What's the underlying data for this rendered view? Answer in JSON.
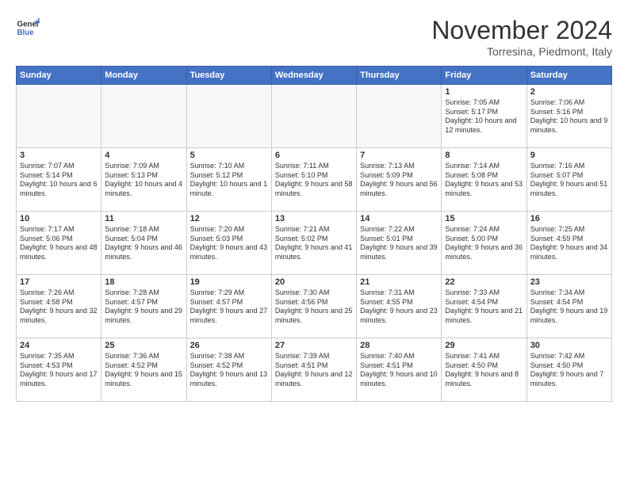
{
  "header": {
    "logo_general": "General",
    "logo_blue": "Blue",
    "month_title": "November 2024",
    "subtitle": "Torresina, Piedmont, Italy"
  },
  "calendar": {
    "days_of_week": [
      "Sunday",
      "Monday",
      "Tuesday",
      "Wednesday",
      "Thursday",
      "Friday",
      "Saturday"
    ],
    "weeks": [
      [
        {
          "day": "",
          "info": ""
        },
        {
          "day": "",
          "info": ""
        },
        {
          "day": "",
          "info": ""
        },
        {
          "day": "",
          "info": ""
        },
        {
          "day": "",
          "info": ""
        },
        {
          "day": "1",
          "info": "Sunrise: 7:05 AM\nSunset: 5:17 PM\nDaylight: 10 hours and 12 minutes."
        },
        {
          "day": "2",
          "info": "Sunrise: 7:06 AM\nSunset: 5:16 PM\nDaylight: 10 hours and 9 minutes."
        }
      ],
      [
        {
          "day": "3",
          "info": "Sunrise: 7:07 AM\nSunset: 5:14 PM\nDaylight: 10 hours and 6 minutes."
        },
        {
          "day": "4",
          "info": "Sunrise: 7:09 AM\nSunset: 5:13 PM\nDaylight: 10 hours and 4 minutes."
        },
        {
          "day": "5",
          "info": "Sunrise: 7:10 AM\nSunset: 5:12 PM\nDaylight: 10 hours and 1 minute."
        },
        {
          "day": "6",
          "info": "Sunrise: 7:11 AM\nSunset: 5:10 PM\nDaylight: 9 hours and 58 minutes."
        },
        {
          "day": "7",
          "info": "Sunrise: 7:13 AM\nSunset: 5:09 PM\nDaylight: 9 hours and 56 minutes."
        },
        {
          "day": "8",
          "info": "Sunrise: 7:14 AM\nSunset: 5:08 PM\nDaylight: 9 hours and 53 minutes."
        },
        {
          "day": "9",
          "info": "Sunrise: 7:16 AM\nSunset: 5:07 PM\nDaylight: 9 hours and 51 minutes."
        }
      ],
      [
        {
          "day": "10",
          "info": "Sunrise: 7:17 AM\nSunset: 5:06 PM\nDaylight: 9 hours and 48 minutes."
        },
        {
          "day": "11",
          "info": "Sunrise: 7:18 AM\nSunset: 5:04 PM\nDaylight: 9 hours and 46 minutes."
        },
        {
          "day": "12",
          "info": "Sunrise: 7:20 AM\nSunset: 5:03 PM\nDaylight: 9 hours and 43 minutes."
        },
        {
          "day": "13",
          "info": "Sunrise: 7:21 AM\nSunset: 5:02 PM\nDaylight: 9 hours and 41 minutes."
        },
        {
          "day": "14",
          "info": "Sunrise: 7:22 AM\nSunset: 5:01 PM\nDaylight: 9 hours and 39 minutes."
        },
        {
          "day": "15",
          "info": "Sunrise: 7:24 AM\nSunset: 5:00 PM\nDaylight: 9 hours and 36 minutes."
        },
        {
          "day": "16",
          "info": "Sunrise: 7:25 AM\nSunset: 4:59 PM\nDaylight: 9 hours and 34 minutes."
        }
      ],
      [
        {
          "day": "17",
          "info": "Sunrise: 7:26 AM\nSunset: 4:58 PM\nDaylight: 9 hours and 32 minutes."
        },
        {
          "day": "18",
          "info": "Sunrise: 7:28 AM\nSunset: 4:57 PM\nDaylight: 9 hours and 29 minutes."
        },
        {
          "day": "19",
          "info": "Sunrise: 7:29 AM\nSunset: 4:57 PM\nDaylight: 9 hours and 27 minutes."
        },
        {
          "day": "20",
          "info": "Sunrise: 7:30 AM\nSunset: 4:56 PM\nDaylight: 9 hours and 25 minutes."
        },
        {
          "day": "21",
          "info": "Sunrise: 7:31 AM\nSunset: 4:55 PM\nDaylight: 9 hours and 23 minutes."
        },
        {
          "day": "22",
          "info": "Sunrise: 7:33 AM\nSunset: 4:54 PM\nDaylight: 9 hours and 21 minutes."
        },
        {
          "day": "23",
          "info": "Sunrise: 7:34 AM\nSunset: 4:54 PM\nDaylight: 9 hours and 19 minutes."
        }
      ],
      [
        {
          "day": "24",
          "info": "Sunrise: 7:35 AM\nSunset: 4:53 PM\nDaylight: 9 hours and 17 minutes."
        },
        {
          "day": "25",
          "info": "Sunrise: 7:36 AM\nSunset: 4:52 PM\nDaylight: 9 hours and 15 minutes."
        },
        {
          "day": "26",
          "info": "Sunrise: 7:38 AM\nSunset: 4:52 PM\nDaylight: 9 hours and 13 minutes."
        },
        {
          "day": "27",
          "info": "Sunrise: 7:39 AM\nSunset: 4:51 PM\nDaylight: 9 hours and 12 minutes."
        },
        {
          "day": "28",
          "info": "Sunrise: 7:40 AM\nSunset: 4:51 PM\nDaylight: 9 hours and 10 minutes."
        },
        {
          "day": "29",
          "info": "Sunrise: 7:41 AM\nSunset: 4:50 PM\nDaylight: 9 hours and 8 minutes."
        },
        {
          "day": "30",
          "info": "Sunrise: 7:42 AM\nSunset: 4:50 PM\nDaylight: 9 hours and 7 minutes."
        }
      ]
    ]
  }
}
